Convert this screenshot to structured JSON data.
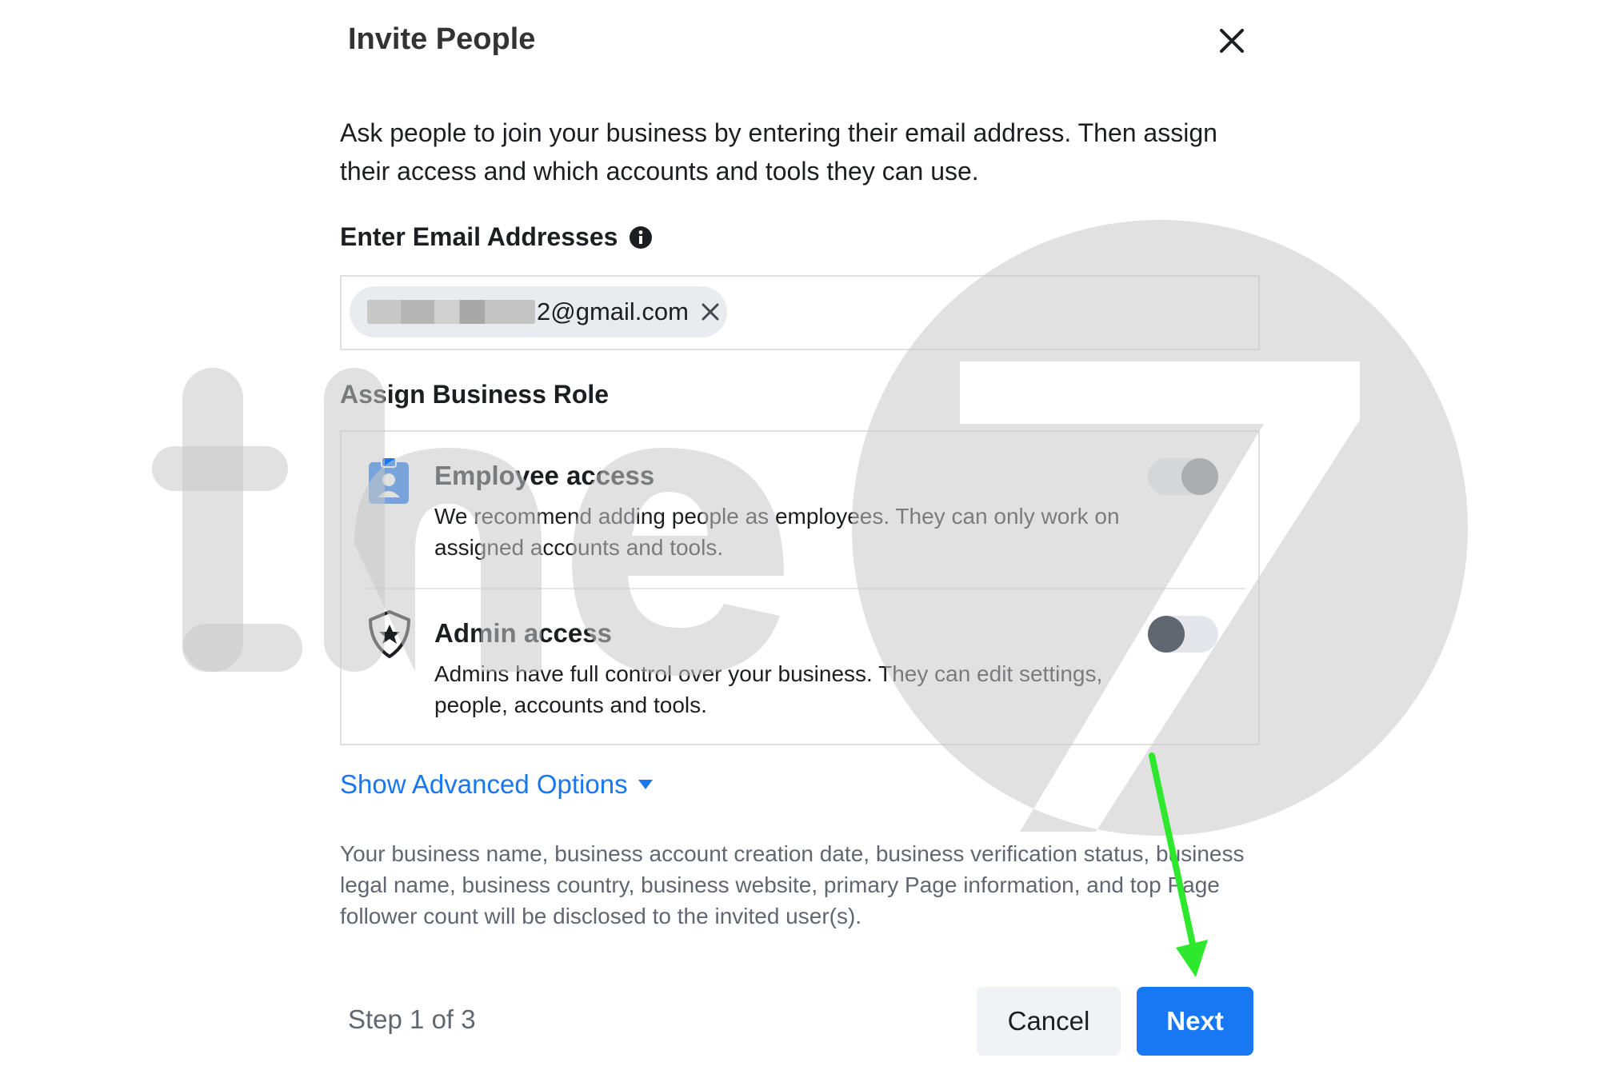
{
  "dialog": {
    "title": "Invite People",
    "intro": "Ask people to join your business by entering their email address. Then assign their access and which accounts and tools they can use."
  },
  "email_section": {
    "label": "Enter Email Addresses",
    "chip_visible_text": "2@gmail.com",
    "info_icon": "info-icon",
    "remove_icon": "close-icon"
  },
  "role_section": {
    "label": "Assign Business Role",
    "roles": [
      {
        "title": "Employee access",
        "description": "We recommend adding people as employees. They can only work on assigned accounts and tools.",
        "icon": "employee-badge-icon",
        "toggle_on": true
      },
      {
        "title": "Admin access",
        "description": "Admins have full control over your business. They can edit settings, people, accounts and tools.",
        "icon": "shield-star-icon",
        "toggle_on": false
      }
    ]
  },
  "advanced": {
    "label": "Show Advanced Options",
    "icon": "caret-down-icon"
  },
  "disclosure": "Your business name, business account creation date, business verification status, business legal name, business country, business website, primary Page information, and top Page follower count will be disclosed to the invited user(s).",
  "footer": {
    "step": "Step 1 of 3",
    "cancel_label": "Cancel",
    "next_label": "Next"
  },
  "colors": {
    "accent": "#1877f2",
    "annotation_arrow": "#2ee82e",
    "watermark": "#c8c8c8"
  }
}
